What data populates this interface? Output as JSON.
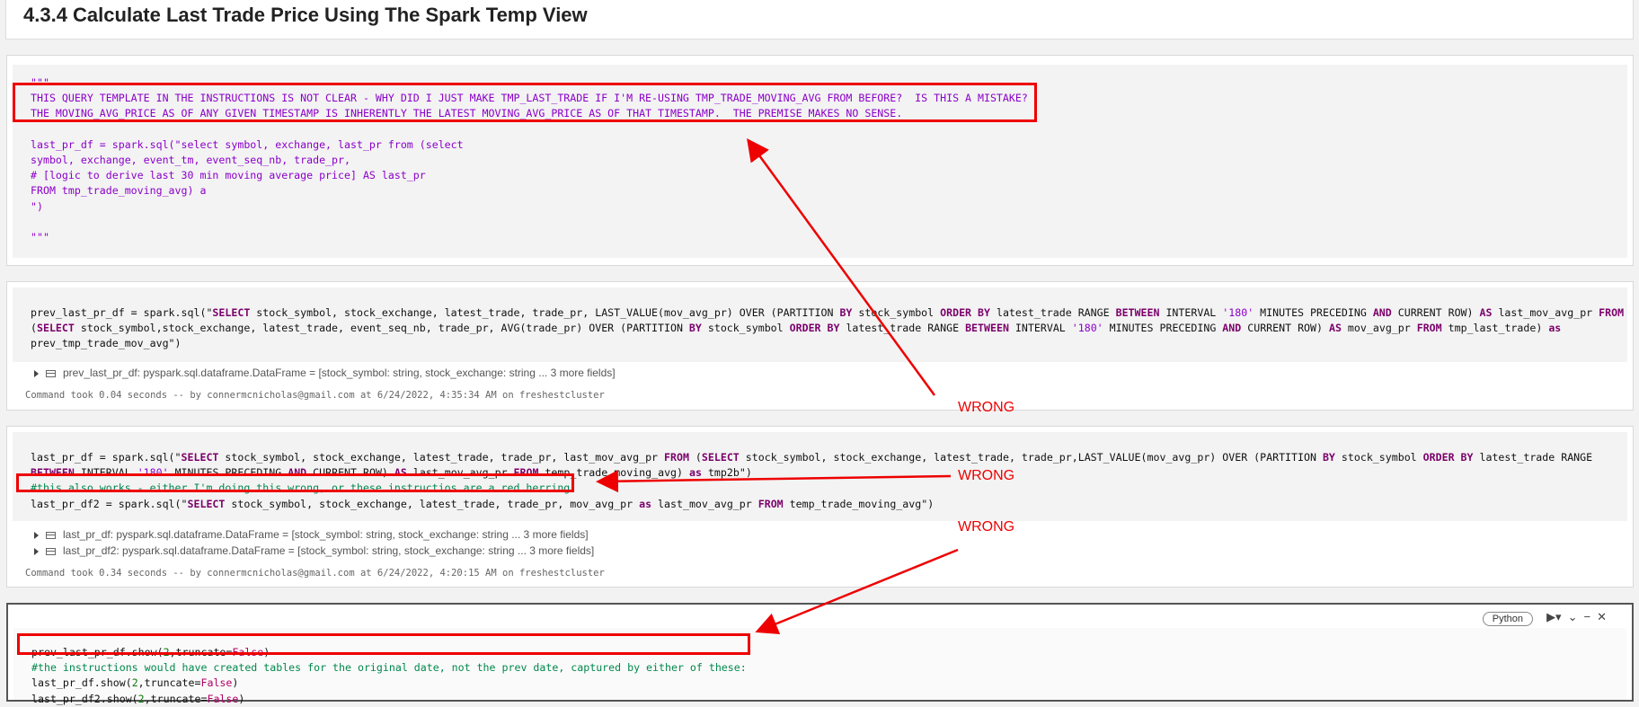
{
  "heading": {
    "title": "4.3.4 Calculate Last Trade Price Using The Spark Temp View"
  },
  "cell1": {
    "lines": [
      "\"\"\"",
      "THIS QUERY TEMPLATE IN THE INSTRUCTIONS IS NOT CLEAR - WHY DID I JUST MAKE TMP_LAST_TRADE IF I'M RE-USING TMP_TRADE_MOVING_AVG FROM BEFORE?  IS THIS A MISTAKE?",
      "THE MOVING_AVG_PRICE AS OF ANY GIVEN TIMESTAMP IS INHERENTLY THE LATEST MOVING_AVG_PRICE AS OF THAT TIMESTAMP.  THE PREMISE MAKES NO SENSE.",
      "",
      "last_pr_df = spark.sql(\"select symbol, exchange, last_pr from (select",
      "symbol, exchange, event_tm, event_seq_nb, trade_pr,",
      "# [logic to derive last 30 min moving average price] AS last_pr",
      "FROM tmp_trade_moving_avg) a",
      "\")",
      "",
      "\"\"\""
    ]
  },
  "cell2": {
    "code_line1_a": "prev_last_pr_df = spark.sql(\"",
    "code_line1_b": "SELECT",
    "code_line1_c": " stock_symbol, stock_exchange, latest_trade, trade_pr, LAST_VALUE(mov_avg_pr) OVER (PARTITION ",
    "code_line1_d": "BY",
    "code_line1_e": " stock_symbol ",
    "code_line1_f": "ORDER BY",
    "code_line1_g": " latest_trade RANGE ",
    "code_line1_h": "BETWEEN",
    "code_line1_i": " INTERVAL ",
    "code_line1_j": "'180'",
    "code_line1_k": " MINUTES PRECEDING ",
    "code_line1_l": "AND",
    "code_line1_m": " CURRENT ROW) ",
    "code_line1_n": "AS",
    "code_line1_o": " last_mov_avg_pr ",
    "code_line1_p": "FROM",
    "code_line2_a": "(",
    "code_line2_b": "SELECT",
    "code_line2_c": " stock_symbol,stock_exchange, latest_trade, event_seq_nb, trade_pr, AVG(trade_pr) OVER (PARTITION ",
    "code_line2_d": "BY",
    "code_line2_e": " stock_symbol ",
    "code_line2_f": "ORDER BY",
    "code_line2_g": " latest_trade RANGE ",
    "code_line2_h": "BETWEEN",
    "code_line2_i": " INTERVAL ",
    "code_line2_j": "'180'",
    "code_line2_k": " MINUTES PRECEDING ",
    "code_line2_l": "AND",
    "code_line2_m": " CURRENT ROW) ",
    "code_line2_n": "AS",
    "code_line2_o": " mov_avg_pr ",
    "code_line2_p": "FROM",
    "code_line2_q": " tmp_last_trade) ",
    "code_line2_r": "as",
    "code_line3": "prev_tmp_trade_mov_avg\")",
    "result": "prev_last_pr_df:  pyspark.sql.dataframe.DataFrame = [stock_symbol: string, stock_exchange: string ... 3 more fields]",
    "footer": "Command took 0.04 seconds -- by connermcnicholas@gmail.com at 6/24/2022, 4:35:34 AM on freshestcluster"
  },
  "cell3": {
    "l1_a": "last_pr_df = spark.sql(\"",
    "l1_b": "SELECT",
    "l1_c": " stock_symbol, stock_exchange, latest_trade, trade_pr, last_mov_avg_pr ",
    "l1_d": "FROM",
    "l1_e": " (",
    "l1_f": "SELECT",
    "l1_g": " stock_symbol, stock_exchange, latest_trade, trade_pr,LAST_VALUE(mov_avg_pr) OVER (PARTITION ",
    "l1_h": "BY",
    "l1_i": " stock_symbol ",
    "l1_j": "ORDER BY",
    "l1_k": " latest_trade RANGE",
    "l2_a": "BETWEEN",
    "l2_b": " INTERVAL ",
    "l2_c": "'180'",
    "l2_d": " MINUTES PRECEDING ",
    "l2_e": "AND",
    "l2_f": " CURRENT ROW) ",
    "l2_g": "AS",
    "l2_h": " last_mov_avg_pr ",
    "l2_i": "FROM",
    "l2_j": " temp_trade_moving_avg) ",
    "l2_k": "as",
    "l2_l": " tmp2b\")",
    "l3": "#this also works - either I'm doing this wrong, or these instructios are a red herring.",
    "l4_a": "last_pr_df2 = spark.sql(\"",
    "l4_b": "SELECT",
    "l4_c": " stock_symbol, stock_exchange, latest_trade, trade_pr, mov_avg_pr ",
    "l4_d": "as",
    "l4_e": " last_mov_avg_pr ",
    "l4_f": "FROM",
    "l4_g": " temp_trade_moving_avg\")",
    "result1": "last_pr_df:  pyspark.sql.dataframe.DataFrame = [stock_symbol: string, stock_exchange: string ... 3 more fields]",
    "result2": "last_pr_df2:  pyspark.sql.dataframe.DataFrame = [stock_symbol: string, stock_exchange: string ... 3 more fields]",
    "footer": "Command took 0.34 seconds -- by connermcnicholas@gmail.com at 6/24/2022, 4:20:15 AM on freshestcluster"
  },
  "cell4": {
    "lang": "Python",
    "l1_a": "prev_last_pr_df.show(",
    "l1_b": "2",
    "l1_c": ",truncate=",
    "l1_d": "False",
    "l1_e": ")",
    "l2": "#the instructions would have created tables for the original date, not the prev date, captured by either of these:",
    "l3_a": "last_pr_df.show(",
    "l3_b": "2",
    "l3_c": ",truncate=",
    "l3_d": "False",
    "l3_e": ")",
    "l4_a": "last_pr_df2.show(",
    "l4_b": "2",
    "l4_c": ",truncate=",
    "l4_d": "False",
    "l4_e": ")"
  },
  "annotations": {
    "wrong1": "WRONG",
    "wrong2": "WRONG",
    "wrong3": "WRONG",
    "color": "#ee0000"
  }
}
